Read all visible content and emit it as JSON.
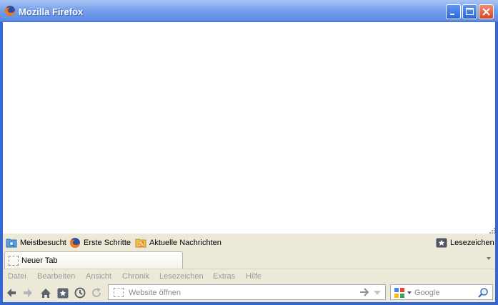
{
  "window": {
    "title": "Mozilla Firefox",
    "app_icon": "firefox-icon",
    "buttons": [
      "minimize-icon",
      "maximize-icon",
      "close-icon"
    ]
  },
  "colors": {
    "titlebar": "#7aa3ec",
    "chrome_bg": "#ece9d8",
    "menu_text_disabled": "#9b9b9b",
    "close_button": "#d6462a"
  },
  "bookmarks": {
    "items": [
      {
        "label": "Meistbesucht",
        "icon": "smart-folder-icon"
      },
      {
        "label": "Erste Schritte",
        "icon": "firefox-icon"
      },
      {
        "label": "Aktuelle Nachrichten",
        "icon": "rss-feed-icon"
      }
    ],
    "menu_label": "Lesezeichen",
    "menu_icon": "bookmark-star-icon"
  },
  "tabs": [
    {
      "label": "Neuer Tab",
      "selected": true
    }
  ],
  "menubar": [
    "Datei",
    "Bearbeiten",
    "Ansicht",
    "Chronik",
    "Lesezeichen",
    "Extras",
    "Hilfe"
  ],
  "navbar": {
    "buttons": [
      "back-arrow-icon",
      "forward-arrow-icon",
      "home-icon",
      "bookmarks-icon",
      "history-icon",
      "reload-icon"
    ],
    "url_placeholder": "Website öffnen",
    "url_value": "",
    "search_placeholder": "Google",
    "search_engine": "google-icon"
  }
}
